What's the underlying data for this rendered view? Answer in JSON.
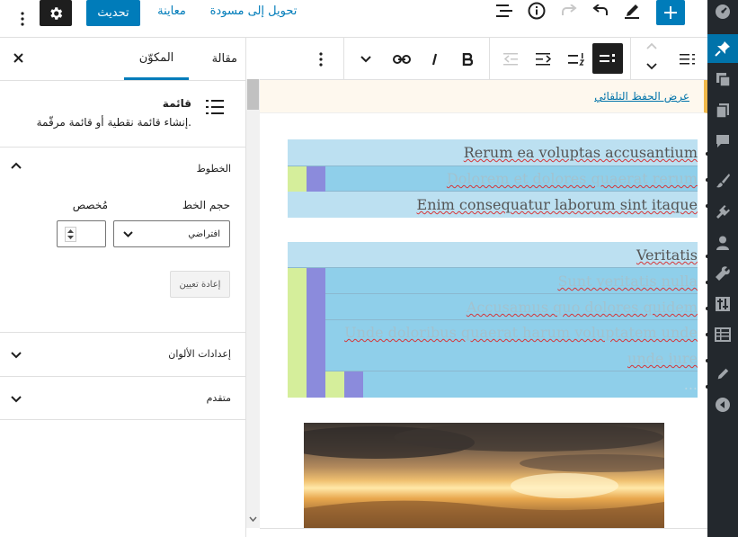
{
  "topbar": {
    "update_label": "تحديث",
    "preview_label": "معاينة",
    "switch_draft_label": "تحويل إلى مسودة"
  },
  "settings": {
    "tabs": [
      "مقالة",
      "المكوّن"
    ],
    "block": {
      "title": "قائمة",
      "description": "إنشاء قائمة نقطية أو قائمة مرقّمة."
    },
    "typography": {
      "heading": "الخطوط",
      "font_size_label": "حجم الخط",
      "custom_label": "مُخصص",
      "font_size_value": "افتراضي",
      "reset_label": "إعادة تعيين"
    },
    "color_settings_label": "إعدادات الألوان",
    "advanced_label": "متقدم"
  },
  "notice": {
    "autosave_link": "عرض الحفظ التلقائي"
  },
  "list_items": [
    "Rerum ea voluptas accusantium",
    "Dolorem et dolores quaerat rerum",
    "Enim consequatur laborum sint itaque",
    "Veritatis",
    "Sunt veritatis nulla",
    "Accusamus quo dolores quidem",
    "Unde doloribus quaerat harum voluptatem unde",
    "unde iure",
    "..."
  ],
  "colors": {
    "primary": "#007cba",
    "admin_bg": "#23282d",
    "list_light": "#bce0f1",
    "list_mid": "#a9d8ee",
    "list_green": "#d5ee9b",
    "list_purple": "#8b8bdc",
    "notice_bg": "#fef8ee"
  }
}
